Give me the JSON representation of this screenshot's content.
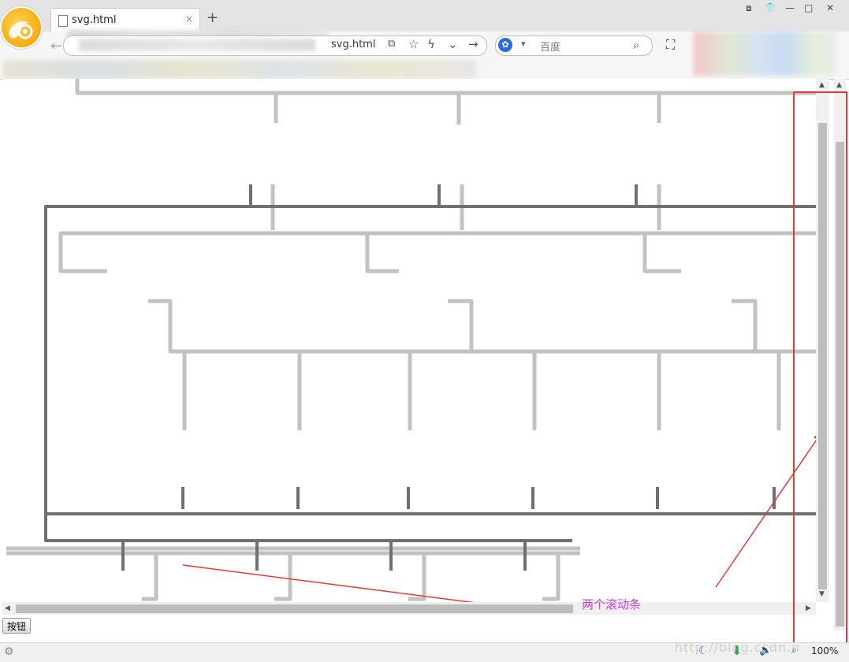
{
  "browser": {
    "tab_title": "svg.html",
    "tab_close": "×",
    "new_tab": "+",
    "url_text": "svg.html",
    "search_engine_name": "百度",
    "window_buttons": [
      "⧇",
      "👕",
      "—",
      "□",
      "✕"
    ]
  },
  "page": {
    "button_label": "按钮",
    "annotation": "两个滚动条"
  },
  "statusbar": {
    "watermark": "http://blog.csdn.n",
    "zoom": "100%"
  },
  "colors": {
    "annotation": "#d43bd4",
    "highlight": "#e53935",
    "pipe_light": "#cfcfcf",
    "pipe_dark": "#7a7a7a"
  },
  "icons": [
    "browser-logo-icon",
    "document-icon",
    "back-arrow-icon",
    "reader-icon",
    "star-icon",
    "lightning-icon",
    "chevron-down-icon",
    "forward-arrow-icon",
    "paw-icon",
    "search-icon",
    "screenshot-icon",
    "gear-icon",
    "moon-icon",
    "download-icon",
    "speaker-icon",
    "zoom-icon"
  ]
}
